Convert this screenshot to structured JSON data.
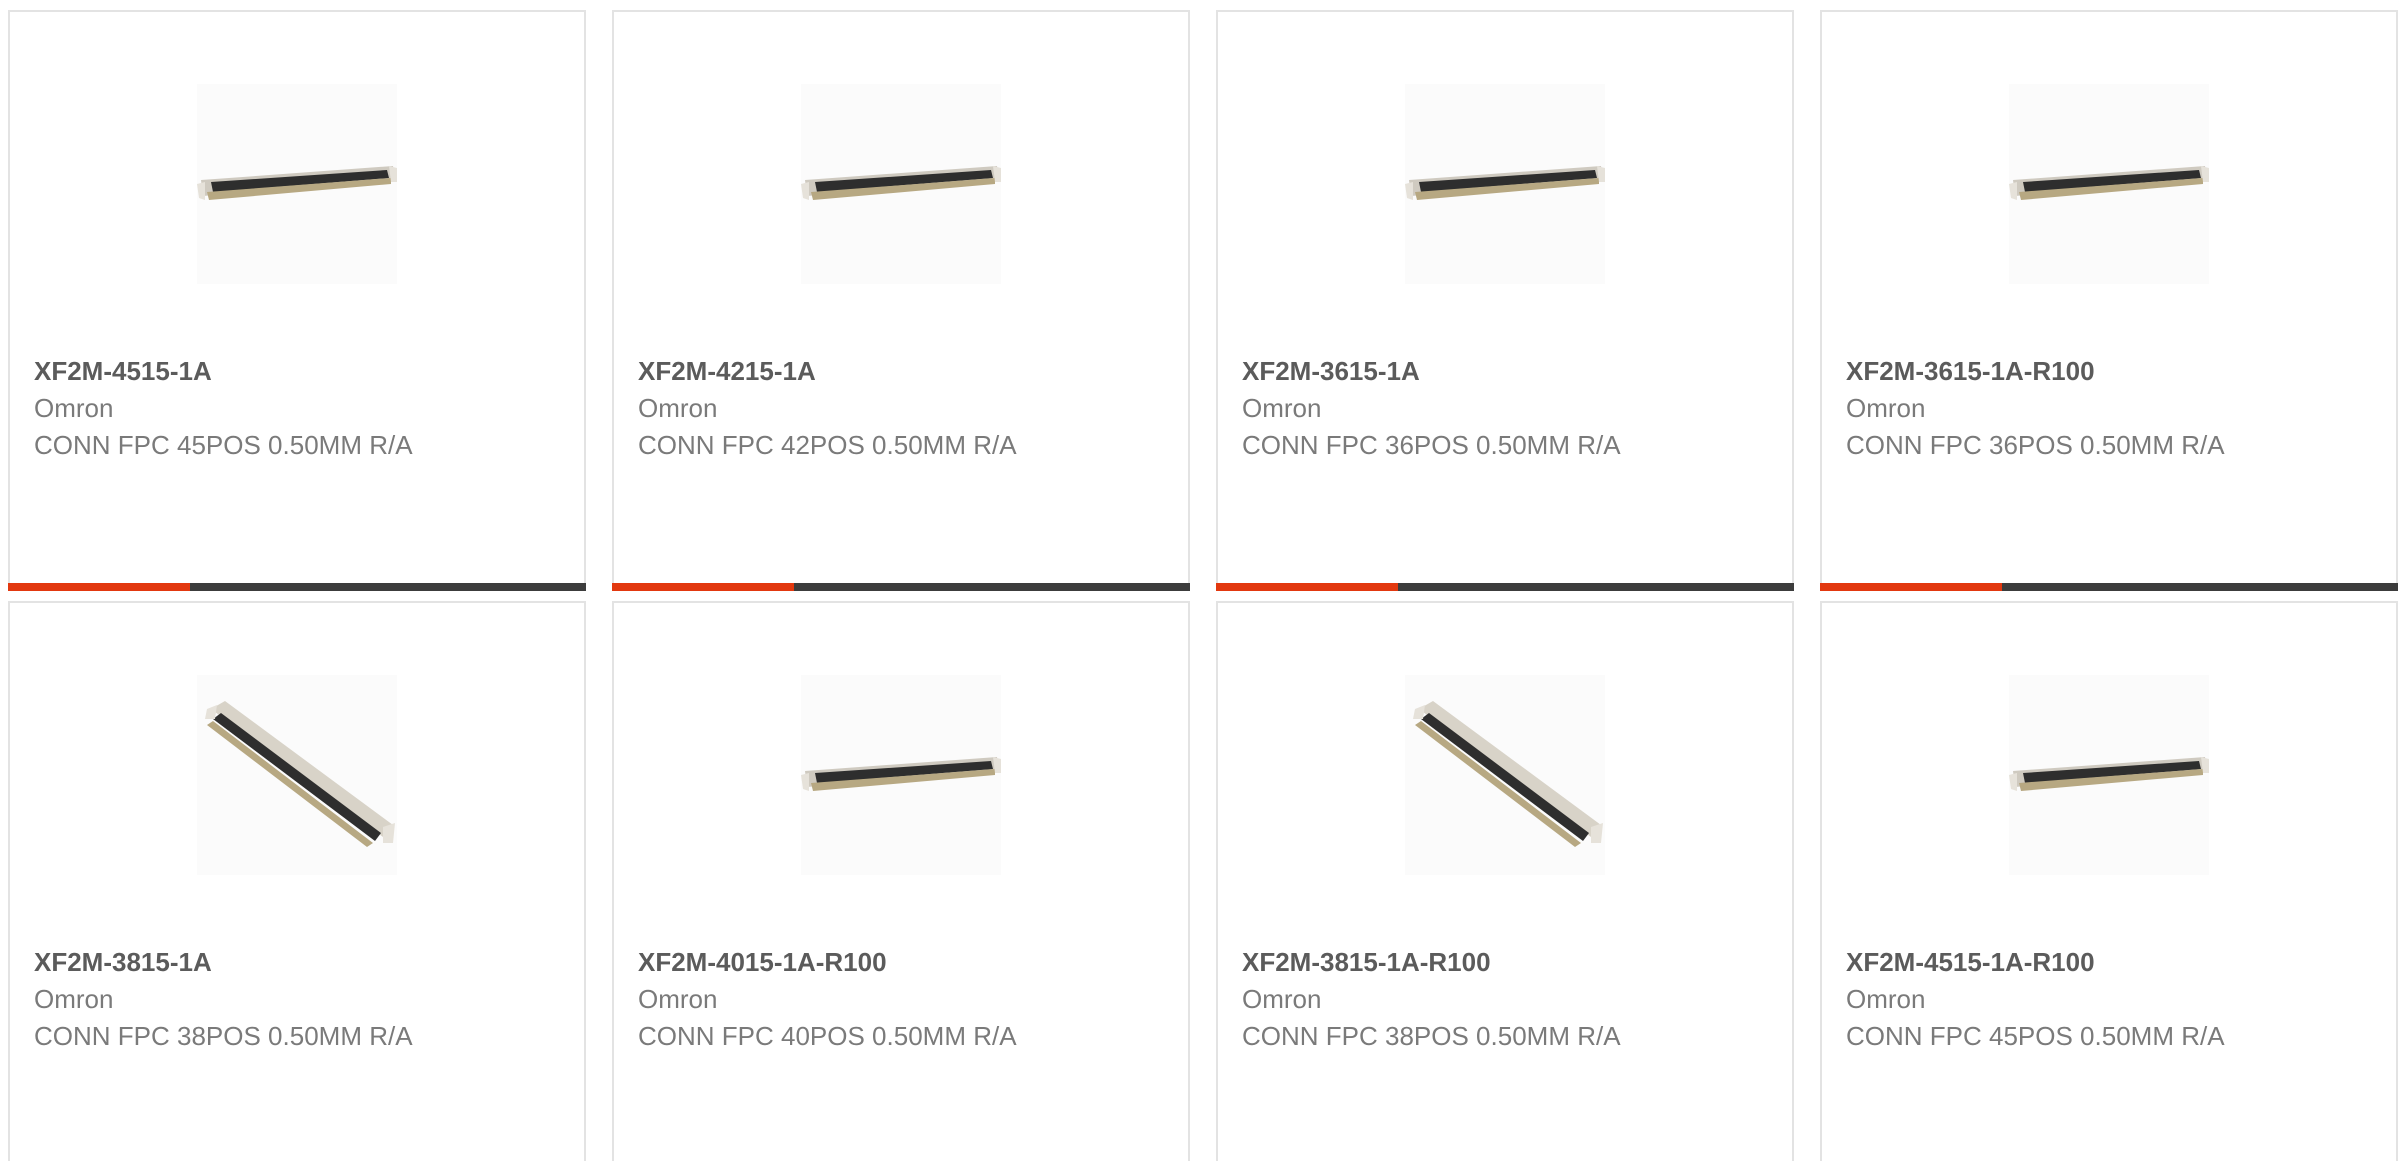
{
  "colors": {
    "accent": "#e2380f",
    "bar": "#3c3c3c",
    "card_border": "#e3e3e3",
    "part_text": "#5b5b5b",
    "secondary_text": "#7a7a7a"
  },
  "products": [
    {
      "part_number": "XF2M-4515-1A",
      "manufacturer": "Omron",
      "description": "CONN FPC 45POS 0.50MM R/A",
      "image_icon": "fpc-connector-flat-icon"
    },
    {
      "part_number": "XF2M-4215-1A",
      "manufacturer": "Omron",
      "description": "CONN FPC 42POS 0.50MM R/A",
      "image_icon": "fpc-connector-flat-icon"
    },
    {
      "part_number": "XF2M-3615-1A",
      "manufacturer": "Omron",
      "description": "CONN FPC 36POS 0.50MM R/A",
      "image_icon": "fpc-connector-flat-icon"
    },
    {
      "part_number": "XF2M-3615-1A-R100",
      "manufacturer": "Omron",
      "description": "CONN FPC 36POS 0.50MM R/A",
      "image_icon": "fpc-connector-flat-icon"
    },
    {
      "part_number": "XF2M-3815-1A",
      "manufacturer": "Omron",
      "description": "CONN FPC 38POS 0.50MM R/A",
      "image_icon": "fpc-connector-angled-icon"
    },
    {
      "part_number": "XF2M-4015-1A-R100",
      "manufacturer": "Omron",
      "description": "CONN FPC 40POS 0.50MM R/A",
      "image_icon": "fpc-connector-flat-icon"
    },
    {
      "part_number": "XF2M-3815-1A-R100",
      "manufacturer": "Omron",
      "description": "CONN FPC 38POS 0.50MM R/A",
      "image_icon": "fpc-connector-angled-icon"
    },
    {
      "part_number": "XF2M-4515-1A-R100",
      "manufacturer": "Omron",
      "description": "CONN FPC 45POS 0.50MM R/A",
      "image_icon": "fpc-connector-flat-icon"
    }
  ]
}
